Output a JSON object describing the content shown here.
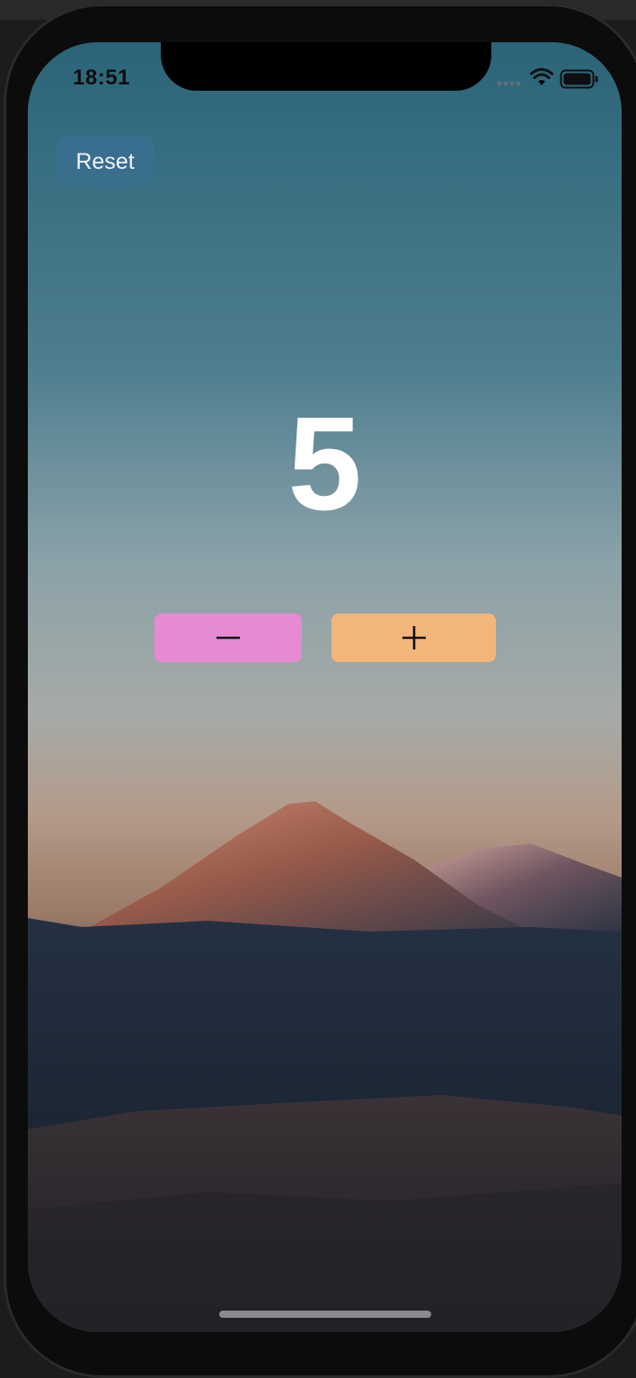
{
  "status_bar": {
    "time": "18:51",
    "icons": [
      "cellular-signal-icon",
      "wifi-icon",
      "battery-icon"
    ]
  },
  "app": {
    "reset_label": "Reset",
    "counter_value": "5",
    "decrement_icon": "minus-icon",
    "increment_icon": "plus-icon"
  },
  "colors": {
    "reset_button": "#3b6f90",
    "decrement_button": "#e68ad3",
    "increment_button": "#f3b67a",
    "counter_text": "#ffffff"
  }
}
